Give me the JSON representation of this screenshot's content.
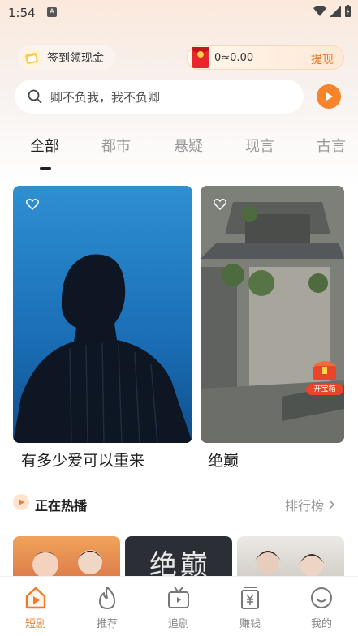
{
  "status_bar": {
    "time": "1:54"
  },
  "header": {
    "checkin_label": "签到领现金",
    "wallet_amount": "0≈0.00",
    "withdraw_label": "提现"
  },
  "search": {
    "placeholder": "卿不负我，我不负卿"
  },
  "tabs": [
    {
      "label": "全部",
      "active": true
    },
    {
      "label": "都市",
      "active": false
    },
    {
      "label": "悬疑",
      "active": false
    },
    {
      "label": "现言",
      "active": false
    },
    {
      "label": "古言",
      "active": false
    }
  ],
  "cards": [
    {
      "title": "有多少爱可以重来"
    },
    {
      "title": "绝巅",
      "badge": "开宝箱"
    }
  ],
  "hot_section": {
    "title": "正在热播",
    "ranking_label": "排行榜",
    "thumb_text": "绝巅"
  },
  "bottom_nav": [
    {
      "label": "短剧",
      "icon": "home-play-icon",
      "active": true
    },
    {
      "label": "推荐",
      "icon": "flame-icon",
      "active": false
    },
    {
      "label": "追剧",
      "icon": "tv-icon",
      "active": false
    },
    {
      "label": "赚钱",
      "icon": "yen-icon",
      "active": false
    },
    {
      "label": "我的",
      "icon": "smile-icon",
      "active": false
    }
  ],
  "colors": {
    "accent": "#f07a2a",
    "active_text": "#222222",
    "inactive_text": "#999999"
  }
}
